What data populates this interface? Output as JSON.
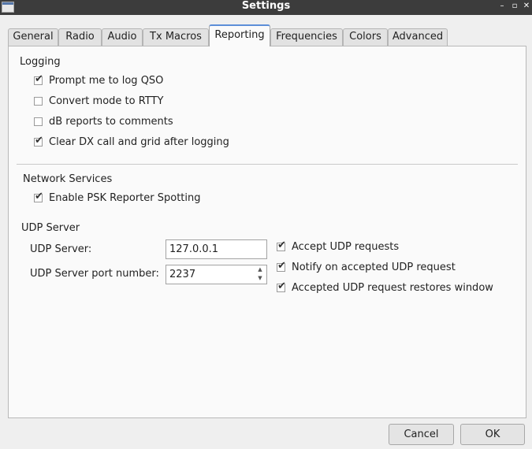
{
  "window": {
    "title": "Settings",
    "minimize": "–",
    "maximize": "▫",
    "close": "✕"
  },
  "tabs": [
    "General",
    "Radio",
    "Audio",
    "Tx Macros",
    "Reporting",
    "Frequencies",
    "Colors",
    "Advanced"
  ],
  "logging": {
    "title": "Logging",
    "items": [
      {
        "label": "Prompt me to log QSO",
        "checked": true
      },
      {
        "label": "Convert mode to RTTY",
        "checked": false
      },
      {
        "label": "dB reports to comments",
        "checked": false
      },
      {
        "label": "Clear DX call and grid after logging",
        "checked": true
      }
    ]
  },
  "network": {
    "title": "Network Services",
    "psk": {
      "label": "Enable PSK Reporter Spotting",
      "checked": true
    }
  },
  "udp": {
    "title": "UDP Server",
    "server_label": "UDP Server:",
    "server_value": "127.0.0.1",
    "port_label": "UDP Server port number:",
    "port_value": "2237",
    "options": [
      {
        "label": "Accept UDP requests",
        "checked": true
      },
      {
        "label": "Notify on accepted UDP request",
        "checked": true
      },
      {
        "label": "Accepted UDP request restores window",
        "checked": true
      }
    ]
  },
  "buttons": {
    "cancel": "Cancel",
    "ok": "OK"
  },
  "check_mark": "✔",
  "spin_up": "▲",
  "spin_down": "▼"
}
